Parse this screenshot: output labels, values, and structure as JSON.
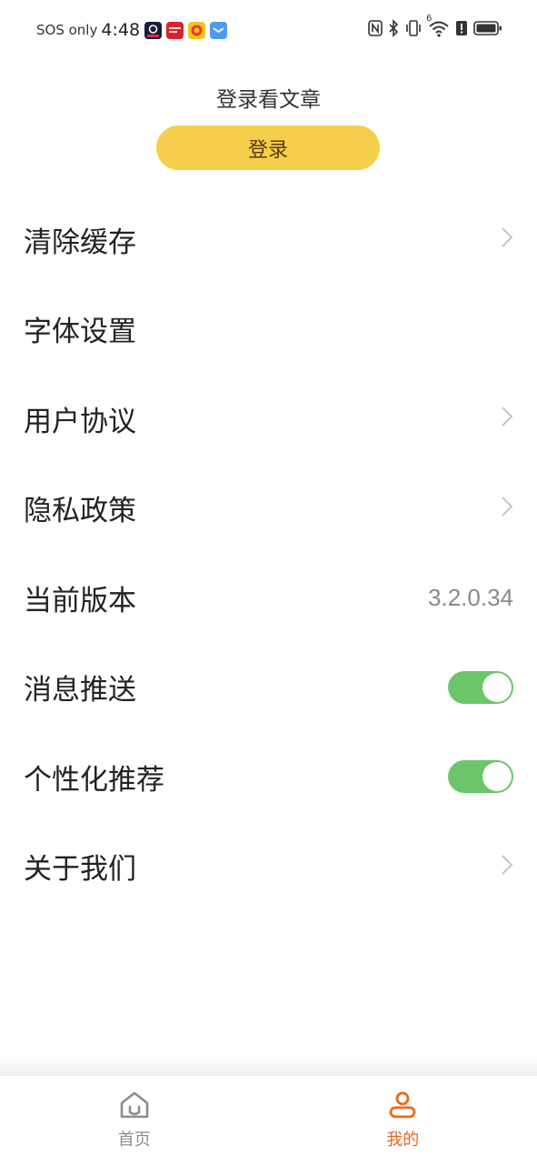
{
  "status_bar": {
    "carrier": "SOS only",
    "time": "4:48",
    "app_icons": [
      "video-app-icon",
      "news-app-icon",
      "emoji-app-icon",
      "message-app-icon"
    ],
    "system_icons": [
      "nfc-icon",
      "bluetooth-icon",
      "vibrate-icon",
      "wifi-icon",
      "alert-icon",
      "battery-icon"
    ],
    "wifi_badge": "6"
  },
  "header": {
    "prompt": "登录看文章",
    "login_button": "登录"
  },
  "settings": {
    "items": [
      {
        "label": "清除缓存",
        "accessory": "chevron"
      },
      {
        "label": "字体设置",
        "accessory": "none"
      },
      {
        "label": "用户协议",
        "accessory": "chevron"
      },
      {
        "label": "隐私政策",
        "accessory": "chevron"
      },
      {
        "label": "当前版本",
        "accessory": "value",
        "value": "3.2.0.34"
      },
      {
        "label": "消息推送",
        "accessory": "toggle",
        "on": true
      },
      {
        "label": "个性化推荐",
        "accessory": "toggle",
        "on": true
      },
      {
        "label": "关于我们",
        "accessory": "chevron"
      }
    ]
  },
  "tab_bar": {
    "tabs": [
      {
        "label": "首页",
        "icon": "home-icon",
        "active": false
      },
      {
        "label": "我的",
        "icon": "profile-icon",
        "active": true
      }
    ]
  },
  "colors": {
    "login_button": "#f5cf4b",
    "toggle_on": "#6cc56a",
    "active_tab": "#e8691e",
    "inactive_tab": "#8d8d8d"
  }
}
